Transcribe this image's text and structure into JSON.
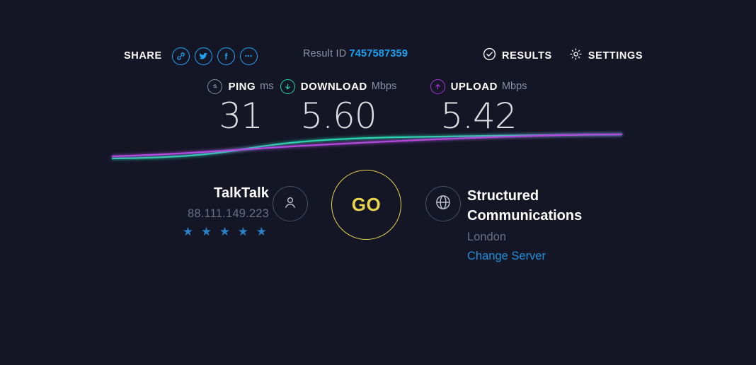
{
  "theme": {
    "background": "#141626",
    "accent_blue": "#1fa2f0",
    "download_color": "#26d7ae",
    "upload_color": "#a435d6",
    "ping_color": "#8c92a4",
    "go_color": "#e8d44d",
    "star_color": "#2b7fc4",
    "muted_text": "#6a7084"
  },
  "topbar": {
    "share_label": "SHARE",
    "share_icons": [
      {
        "name": "link-icon"
      },
      {
        "name": "twitter-icon"
      },
      {
        "name": "facebook-icon"
      },
      {
        "name": "more-icon"
      }
    ],
    "result_id_label": "Result ID",
    "result_id_value": "7457587359",
    "results_label": "RESULTS",
    "settings_label": "SETTINGS"
  },
  "metrics": [
    {
      "id": "ping",
      "icon": "ping-icon",
      "name": "PING",
      "unit": "ms",
      "value": "31"
    },
    {
      "id": "download",
      "icon": "download-arrow-icon",
      "name": "DOWNLOAD",
      "unit": "Mbps",
      "value": "5.60"
    },
    {
      "id": "upload",
      "icon": "upload-arrow-icon",
      "name": "UPLOAD",
      "unit": "Mbps",
      "value": "5.42"
    }
  ],
  "chart_data": {
    "type": "line",
    "title": "",
    "xlabel": "",
    "ylabel": "",
    "grid": false,
    "legend": "none",
    "series": [
      {
        "name": "Download",
        "color": "#26d7ae",
        "points": [
          [
            159,
            224
          ],
          [
            230,
            222
          ],
          [
            300,
            217
          ],
          [
            360,
            208
          ],
          [
            420,
            200
          ],
          [
            500,
            196
          ],
          [
            600,
            194
          ],
          [
            700,
            192
          ],
          [
            800,
            191
          ],
          [
            878,
            190
          ]
        ]
      },
      {
        "name": "Upload",
        "color": "#b44ae0",
        "points": [
          [
            159,
            221
          ],
          [
            230,
            218
          ],
          [
            300,
            214
          ],
          [
            360,
            210
          ],
          [
            420,
            206
          ],
          [
            500,
            202
          ],
          [
            600,
            198
          ],
          [
            700,
            195
          ],
          [
            800,
            192
          ],
          [
            878,
            190
          ]
        ]
      }
    ]
  },
  "isp": {
    "name": "TalkTalk",
    "ip": "88.111.149.223",
    "rating": 5,
    "stars_text": "★ ★ ★ ★ ★",
    "icon": "person-icon"
  },
  "go_button": {
    "label": "GO"
  },
  "server": {
    "name": "Structured Communications",
    "city": "London",
    "change_label": "Change Server",
    "icon": "globe-icon"
  }
}
